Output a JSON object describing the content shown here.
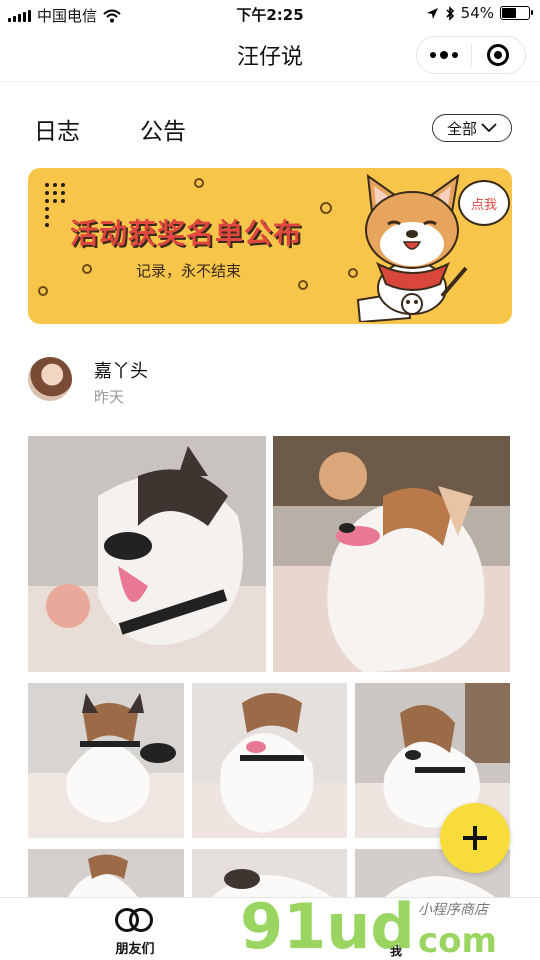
{
  "status_bar": {
    "carrier": "中国电信",
    "time": "下午2:25",
    "battery": "54%",
    "battery_level": 0.54
  },
  "nav": {
    "title": "汪仔说",
    "more_icon": "more-dots-icon",
    "close_icon": "target-circle-icon"
  },
  "tabs": {
    "items": [
      {
        "label": "日志",
        "active": true
      },
      {
        "label": "公告",
        "active": false
      }
    ],
    "filter_label": "全部"
  },
  "banner": {
    "title": "活动获奖名单公布",
    "subtitle": "记录，永不结束",
    "bubble": "点我",
    "colors": {
      "background": "#f6c54a",
      "title": "#e0473f"
    }
  },
  "post": {
    "author": "嘉丫头",
    "time": "昨天",
    "photo_count_visible": 8
  },
  "fab": {
    "icon": "plus-icon",
    "color": "#f8dc3c"
  },
  "tabbar": {
    "items": [
      {
        "label": "朋友们",
        "icon": "two-rings-icon"
      },
      {
        "label": "我",
        "icon": "person-icon"
      }
    ]
  },
  "watermark": {
    "brand": "91ud",
    "domain": "com",
    "tagline": "小程序商店"
  }
}
